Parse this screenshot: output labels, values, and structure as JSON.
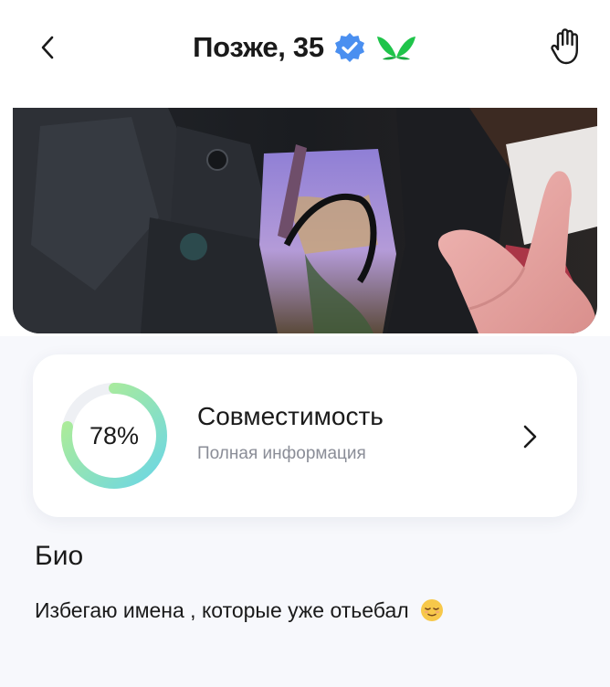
{
  "header": {
    "title": "Позже, 35",
    "back_icon": "chevron-left-icon",
    "verified_icon": "verified-badge-icon",
    "butterfly_icon": "butterfly-icon",
    "wave_icon": "raised-hand-icon"
  },
  "photo": {
    "description_icon": "profile-photo"
  },
  "compatibility": {
    "percent_label": "78%",
    "percent_value": 0.78,
    "title": "Совместимость",
    "subtitle": "Полная информация",
    "chevron_icon": "chevron-right-icon"
  },
  "bio": {
    "title": "Био",
    "text": "Избегаю имена , которые уже отьебал",
    "emoji_icon": "relieved-face-emoji"
  },
  "colors": {
    "verified_blue": "#4a8ff0",
    "butterfly_green": "#1fc44a",
    "ring_start": "#b9f08a",
    "ring_end": "#6ad6e6",
    "ring_track": "#eef0f4"
  }
}
